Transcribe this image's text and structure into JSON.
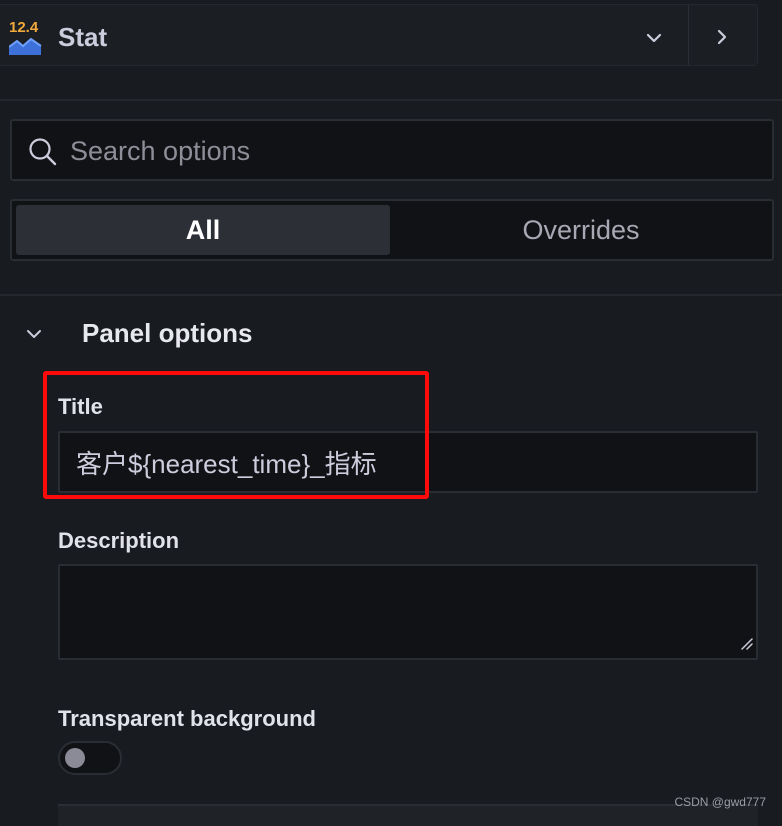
{
  "viz_picker": {
    "icon_number": "12.4",
    "name": "Stat",
    "icon": "stat-viz-icon",
    "expand_icon": "chevron-down-icon",
    "collapse_icon": "chevron-right-icon"
  },
  "search": {
    "placeholder": "Search options",
    "value": ""
  },
  "tabs": [
    {
      "label": "All",
      "active": true
    },
    {
      "label": "Overrides",
      "active": false
    }
  ],
  "panel_options": {
    "section_title": "Panel options",
    "title_label": "Title",
    "title_value": "客户${nearest_time}_指标",
    "description_label": "Description",
    "description_value": "",
    "transparent_label": "Transparent background",
    "transparent_enabled": false
  },
  "watermark": "CSDN @gwd777",
  "colors": {
    "accent_highlight": "#ff0a0a",
    "stat_number": "#f2a93b",
    "stat_graph": "#3d71d9"
  }
}
